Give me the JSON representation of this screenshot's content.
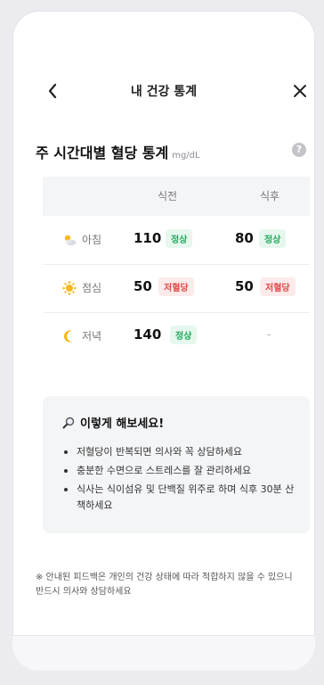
{
  "header": {
    "title": "내 건강 통계"
  },
  "section": {
    "title": "주 시간대별 혈당 통계",
    "unit": "mg/dL",
    "help": "?"
  },
  "table": {
    "columns": [
      "식전",
      "식후"
    ],
    "rows": [
      {
        "label": "아침",
        "icon": "partly-sunny-icon",
        "before": {
          "value": "110",
          "status": "정상"
        },
        "after": {
          "value": "80",
          "status": "정상"
        }
      },
      {
        "label": "점심",
        "icon": "sun-icon",
        "before": {
          "value": "50",
          "status": "저혈당"
        },
        "after": {
          "value": "50",
          "status": "저혈당"
        }
      },
      {
        "label": "저녁",
        "icon": "moon-icon",
        "before": {
          "value": "140",
          "status": "정상"
        },
        "after": {
          "value": "-"
        }
      }
    ]
  },
  "tips": {
    "title": "이렇게 해보세요!",
    "items": [
      "저혈당이 반복되면 의사와 꼭 상담하세요",
      "충분한 수면으로 스트레스를 잘 관리하세요",
      "식사는 식이섬유 및 단백질 위주로 하며 식후 30분 산책하세요"
    ]
  },
  "note": "※ 안내된 피드백은 개인의 건강 상태에 따라 적합하지 않을 수 있으니 반드시 의사와 상담하세요",
  "colors": {
    "normal": "#23a85d",
    "low": "#e44848",
    "sun": "#f6b81e",
    "moon": "#f5b300"
  }
}
